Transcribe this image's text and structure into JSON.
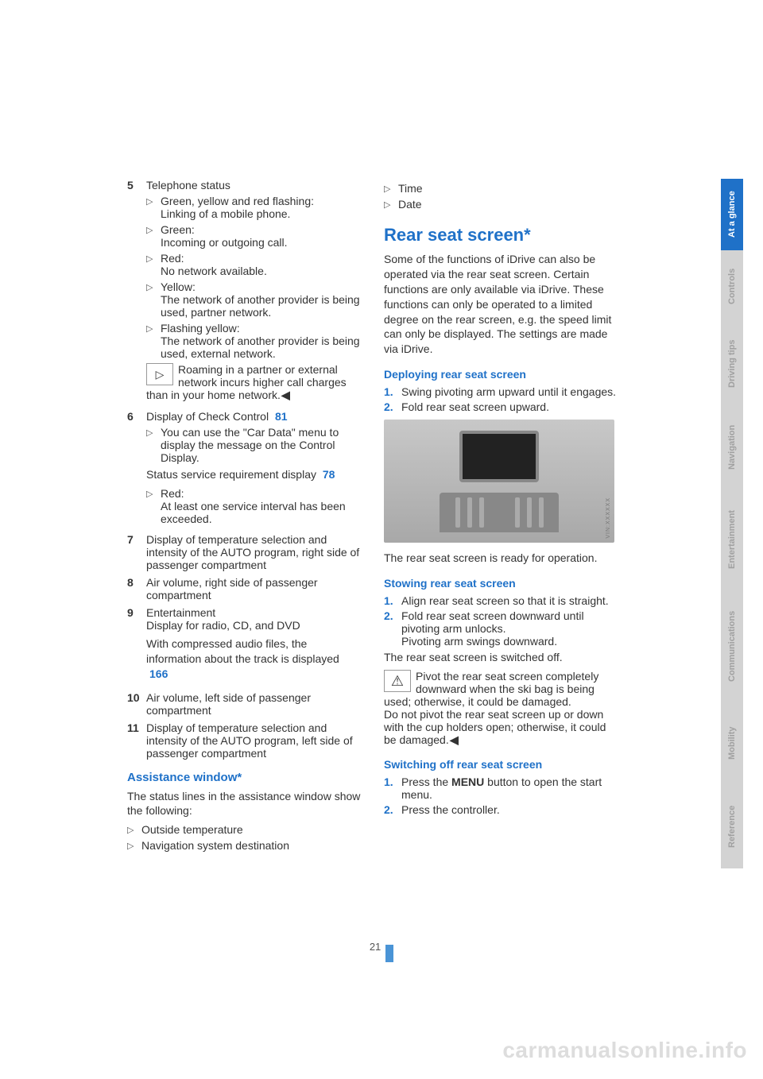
{
  "page_number": "21",
  "watermark": "carmanualsonline.info",
  "vin_label": "VIN:XXXXXX",
  "side_tabs": [
    {
      "label": "At a glance",
      "active": true
    },
    {
      "label": "Controls",
      "active": false
    },
    {
      "label": "Driving tips",
      "active": false
    },
    {
      "label": "Navigation",
      "active": false
    },
    {
      "label": "Entertainment",
      "active": false
    },
    {
      "label": "Communications",
      "active": false
    },
    {
      "label": "Mobility",
      "active": false
    },
    {
      "label": "Reference",
      "active": false
    }
  ],
  "left": {
    "item5": {
      "num": "5",
      "title": "Telephone status",
      "bullets": [
        {
          "head": "Green, yellow and red flashing:",
          "body": "Linking of a mobile phone."
        },
        {
          "head": "Green:",
          "body": "Incoming or outgoing call."
        },
        {
          "head": "Red:",
          "body": "No network available."
        },
        {
          "head": "Yellow:",
          "body": "The network of another provider is being used, partner network."
        },
        {
          "head": "Flashing yellow:",
          "body": "The network of another provider is being used, external network."
        }
      ],
      "note": "Roaming in a partner or external network incurs higher call charges than in your home network."
    },
    "item6": {
      "num": "6",
      "title": "Display of Check Control",
      "link": "81",
      "bullet1": "You can use the \"Car Data\" menu to display the message on the Control Display.",
      "status_line": "Status service requirement display",
      "link2": "78",
      "bullet2_head": "Red:",
      "bullet2_body": "At least one service interval has been exceeded."
    },
    "item7": {
      "num": "7",
      "body": "Display of temperature selection and intensity of the AUTO program, right side of passenger compartment"
    },
    "item8": {
      "num": "8",
      "body": "Air volume, right side of passenger compartment"
    },
    "item9": {
      "num": "9",
      "title": "Entertainment",
      "sub": "Display for radio, CD, and DVD",
      "body2": "With compressed audio files, the information about the track is displayed",
      "link": "166"
    },
    "item10": {
      "num": "10",
      "body": "Air volume, left side of passenger compartment"
    },
    "item11": {
      "num": "11",
      "body": "Display of temperature selection and intensity of the AUTO program, left side of passenger compartment"
    },
    "assist": {
      "heading": "Assistance window*",
      "intro": "The status lines in the assistance window show the following:",
      "bullets": [
        "Outside temperature",
        "Navigation system destination"
      ]
    }
  },
  "right": {
    "top_bullets": [
      "Time",
      "Date"
    ],
    "rear_heading": "Rear seat screen*",
    "rear_intro": "Some of the functions of iDrive can also be operated via the rear seat screen. Certain functions are only available via iDrive. These functions can only be operated to a limited degree on the rear screen, e.g. the speed limit can only be displayed. The settings are made via iDrive.",
    "deploy": {
      "heading": "Deploying rear seat screen",
      "steps": [
        "Swing pivoting arm upward until it engages.",
        "Fold rear seat screen upward."
      ]
    },
    "after_img": "The rear seat screen is ready for operation.",
    "stow": {
      "heading": "Stowing rear seat screen",
      "steps": [
        "Align rear seat screen so that it is straight.",
        "Fold rear seat screen downward until pivoting arm unlocks.\nPivoting arm swings downward."
      ],
      "after": "The rear seat screen is switched off.",
      "warn": "Pivot the rear seat screen completely downward when the ski bag is being used; otherwise, it could be damaged.\nDo not pivot the rear seat screen up or down with the cup holders open; otherwise, it could be damaged."
    },
    "switch": {
      "heading": "Switching off rear seat screen",
      "step1_pre": "Press the ",
      "step1_bold": "MENU",
      "step1_post": " button to open the start menu.",
      "step2": "Press the controller."
    }
  }
}
